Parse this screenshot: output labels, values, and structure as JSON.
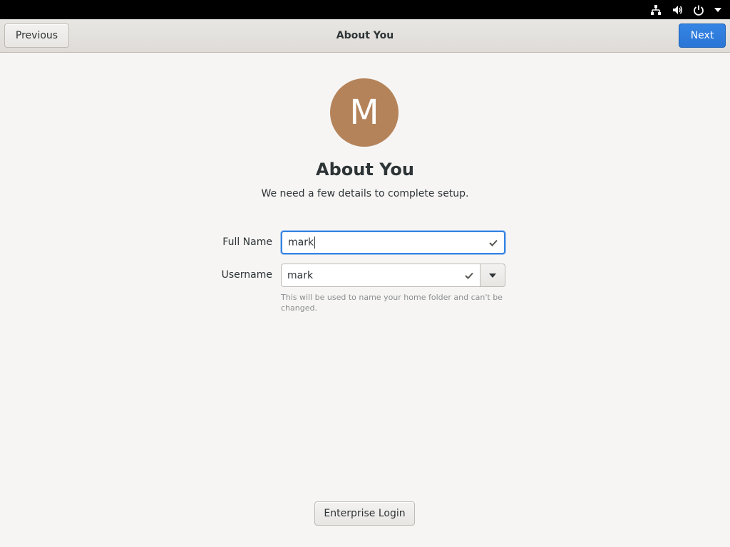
{
  "system_bar": {
    "icons": [
      "network-icon",
      "volume-icon",
      "power-icon",
      "menu-arrow-icon"
    ]
  },
  "header": {
    "title": "About You",
    "previous_label": "Previous",
    "next_label": "Next"
  },
  "avatar": {
    "initial": "M",
    "color": "#b5835a"
  },
  "main": {
    "title": "About You",
    "subtitle": "We need a few details to complete setup."
  },
  "form": {
    "full_name_label": "Full Name",
    "full_name_value": "mark",
    "username_label": "Username",
    "username_value": "mark",
    "hint": "This will be used to name your home folder and can't be changed."
  },
  "footer": {
    "enterprise_label": "Enterprise Login"
  },
  "colors": {
    "accent": "#3584e4",
    "avatar": "#b5835a"
  }
}
